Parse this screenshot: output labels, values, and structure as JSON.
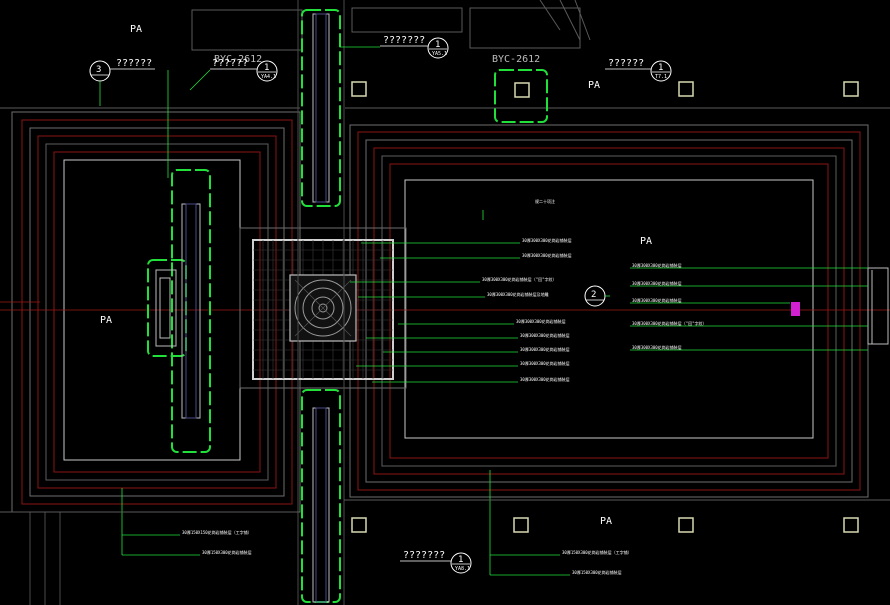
{
  "drawing": {
    "area_labels": [
      "PA",
      "PA",
      "PA",
      "PA",
      "PA"
    ],
    "block_labels": [
      "BYC-2612",
      "BYC-2612"
    ],
    "callouts": [
      {
        "num": "3",
        "sub": "",
        "text": "??????"
      },
      {
        "num": "1",
        "sub": "YA4.1",
        "text": "??????"
      },
      {
        "num": "1",
        "sub": "YA5.1",
        "text": "???????"
      },
      {
        "num": "1",
        "sub": "T7.1",
        "text": "??????"
      },
      {
        "num": "2",
        "sub": "",
        "text": ""
      },
      {
        "num": "1",
        "sub": "YA8.1",
        "text": "???????"
      }
    ],
    "center_notes": [
      "规二十项注",
      "30厚300X300花岗岩铺装层",
      "30厚300X300花岗岩铺装层",
      "30厚300X300花岗岩铺装层（\"回\"字纹）",
      "30厚300X300花岗岩铺装层及地雕",
      "30厚300X300花岗岩铺装层",
      "30厚300X300花岗岩铺装层",
      "30厚300X300花岗岩铺装层",
      "30厚300X300花岗岩铺装层",
      "30厚300X300花岗岩铺装层"
    ],
    "right_notes": [
      "30厚300X300花岗岩铺装层",
      "30厚300X300花岗岩铺装层",
      "30厚300X300花岗岩铺装层",
      "30厚300X300花岗岩铺装层（\"回\"字纹）",
      "30厚300X300花岗岩铺装层"
    ],
    "bottom_left_notes": [
      "30厚150X150花岗岩铺装层（工字铺）",
      "30厚150X300花岗岩铺装层"
    ],
    "bottom_right_notes": [
      "30厚150X300花岗岩铺装层（工字铺）",
      "30厚150X300花岗岩铺装层"
    ],
    "colors": {
      "background": "#000000",
      "green": "#22e03a",
      "white_line": "#d0d0d0",
      "gray_line": "#7a7a7a",
      "red_line": "#a01818",
      "magenta": "#d020d0"
    }
  }
}
